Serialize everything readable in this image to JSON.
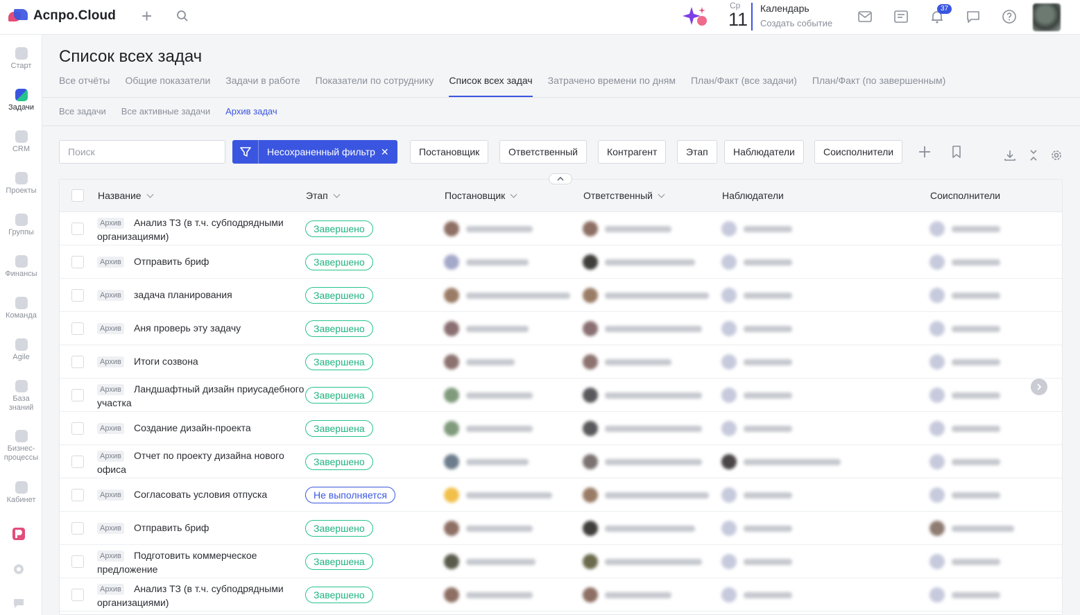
{
  "topbar": {
    "brand": "Аспро.Cloud",
    "calendar": {
      "weekday": "Ср",
      "day": "11",
      "title": "Календарь",
      "subtitle": "Создать событие"
    },
    "notifications_count": "37"
  },
  "leftnav": {
    "items": [
      {
        "label": "Старт"
      },
      {
        "label": "Задачи"
      },
      {
        "label": "CRM"
      },
      {
        "label": "Проекты"
      },
      {
        "label": "Группы"
      },
      {
        "label": "Финансы"
      },
      {
        "label": "Команда"
      },
      {
        "label": "Agile"
      },
      {
        "label": "База знаний"
      },
      {
        "label": "Бизнес-процессы"
      },
      {
        "label": "Кабинет"
      }
    ]
  },
  "page": {
    "title": "Список всех задач",
    "tabs": [
      {
        "label": "Все отчёты"
      },
      {
        "label": "Общие показатели"
      },
      {
        "label": "Задачи в работе"
      },
      {
        "label": "Показатели по сотруднику"
      },
      {
        "label": "Список всех задач"
      },
      {
        "label": "Затрачено времени по дням"
      },
      {
        "label": "План/Факт (все задачи)"
      },
      {
        "label": "План/Факт (по завершенным)"
      }
    ],
    "subtabs": [
      {
        "label": "Все задачи"
      },
      {
        "label": "Все активные задачи"
      },
      {
        "label": "Архив задач"
      }
    ]
  },
  "filters": {
    "search_placeholder": "Поиск",
    "active_filter": "Несохраненный фильтр",
    "active_filter_close": "✕",
    "chips": [
      "Постановщик",
      "Ответственный",
      "Контрагент",
      "Этап",
      "Наблюдатели",
      "Соисполнители"
    ]
  },
  "table": {
    "columns": [
      "Название",
      "Этап",
      "Постановщик",
      "Ответственный",
      "Наблюдатели",
      "Соисполнители"
    ],
    "archive_tag": "Архив",
    "rows": [
      {
        "name": "Анализ ТЗ (в т.ч. субподрядными организациями)",
        "stage": "Завершено",
        "stage_type": "done"
      },
      {
        "name": "Отправить бриф",
        "stage": "Завершено",
        "stage_type": "done"
      },
      {
        "name": "задача планирования",
        "stage": "Завершено",
        "stage_type": "done"
      },
      {
        "name": "Аня проверь эту задачу",
        "stage": "Завершено",
        "stage_type": "done"
      },
      {
        "name": "Итоги созвона",
        "stage": "Завершена",
        "stage_type": "done"
      },
      {
        "name": "Ландшафтный дизайн приусадебного участка",
        "stage": "Завершена",
        "stage_type": "done"
      },
      {
        "name": "Создание дизайн-проекта",
        "stage": "Завершена",
        "stage_type": "done"
      },
      {
        "name": "Отчет по проекту дизайна нового офиса",
        "stage": "Завершено",
        "stage_type": "done"
      },
      {
        "name": "Согласовать условия отпуска",
        "stage": "Не выполняется",
        "stage_type": "notdone"
      },
      {
        "name": "Отправить бриф",
        "stage": "Завершено",
        "stage_type": "done"
      },
      {
        "name": "Подготовить коммерческое предложение",
        "stage": "Завершена",
        "stage_type": "done"
      },
      {
        "name": "Анализ ТЗ (в т.ч. субподрядными организациями)",
        "stage": "Завершено",
        "stage_type": "done"
      }
    ]
  },
  "colors": {
    "accent": "#3a56e0",
    "success": "#26c38b"
  }
}
